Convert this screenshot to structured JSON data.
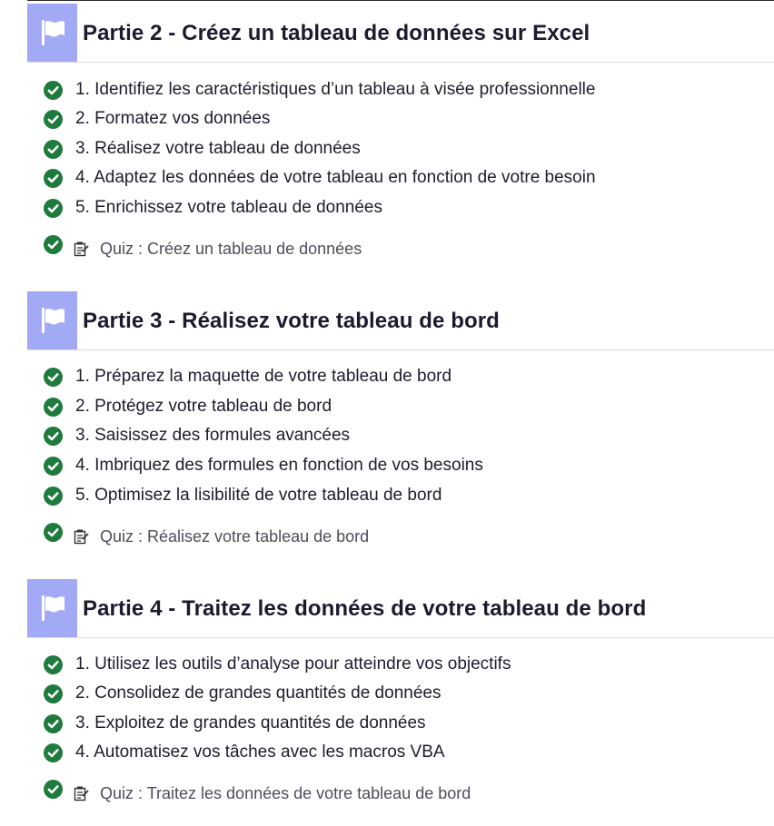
{
  "colors": {
    "flag_bg": "#a3aaf5",
    "check_green": "#1f7a3d",
    "title_text": "#1d1a2f",
    "quiz_text": "#4e4e5a"
  },
  "icons": {
    "part_icon": "flag-icon",
    "done_icon": "check-circle-icon",
    "quiz_icon": "quiz-note-icon"
  },
  "parts": [
    {
      "title": "Partie 2 - Créez un tableau de données sur Excel",
      "chapters": [
        "1. Identifiez les caractéristiques d’un tableau à visée professionnelle",
        "2. Formatez vos données",
        "3. Réalisez votre tableau de données",
        "4. Adaptez les données de votre tableau en fonction de votre besoin",
        "5. Enrichissez votre tableau de données"
      ],
      "quiz": "Quiz : Créez un tableau de données"
    },
    {
      "title": "Partie 3 - Réalisez votre tableau de bord",
      "chapters": [
        "1. Préparez la maquette de votre tableau de bord",
        "2. Protégez votre tableau de bord",
        "3. Saisissez des formules avancées",
        "4. Imbriquez des formules en fonction de vos besoins",
        "5. Optimisez la lisibilité de votre tableau de bord"
      ],
      "quiz": "Quiz : Réalisez votre tableau de bord"
    },
    {
      "title": "Partie 4 - Traitez les données de votre tableau de bord",
      "chapters": [
        "1. Utilisez les outils d’analyse pour atteindre vos objectifs",
        "2. Consolidez de grandes quantités de données",
        "3. Exploitez de grandes quantités de données",
        "4. Automatisez vos tâches avec les macros VBA"
      ],
      "quiz": "Quiz : Traitez les données de votre tableau de bord"
    }
  ]
}
